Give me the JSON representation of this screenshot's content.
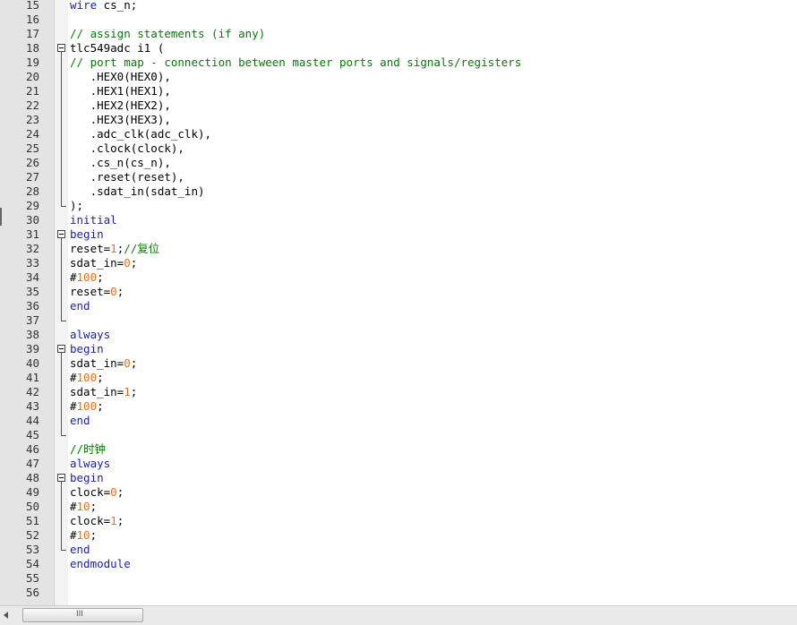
{
  "editor": {
    "lines": [
      {
        "n": "15",
        "fold": false,
        "tokens": [
          {
            "t": "wire",
            "c": "kw"
          },
          {
            "t": " cs_n;",
            "c": ""
          }
        ]
      },
      {
        "n": "16",
        "fold": false,
        "tokens": []
      },
      {
        "n": "17",
        "fold": false,
        "tokens": [
          {
            "t": "// assign statements (if any)",
            "c": "cm"
          }
        ]
      },
      {
        "n": "18",
        "fold": true,
        "tokens": [
          {
            "t": "tlc549adc i1 (",
            "c": ""
          }
        ]
      },
      {
        "n": "19",
        "fold": false,
        "tokens": [
          {
            "t": "// port map - connection between master ports and signals/registers",
            "c": "cm"
          }
        ]
      },
      {
        "n": "20",
        "fold": false,
        "tokens": [
          {
            "t": "   .HEX0(HEX0),",
            "c": ""
          }
        ]
      },
      {
        "n": "21",
        "fold": false,
        "tokens": [
          {
            "t": "   .HEX1(HEX1),",
            "c": ""
          }
        ]
      },
      {
        "n": "22",
        "fold": false,
        "tokens": [
          {
            "t": "   .HEX2(HEX2),",
            "c": ""
          }
        ]
      },
      {
        "n": "23",
        "fold": false,
        "tokens": [
          {
            "t": "   .HEX3(HEX3),",
            "c": ""
          }
        ]
      },
      {
        "n": "24",
        "fold": false,
        "tokens": [
          {
            "t": "   .adc_clk(adc_clk),",
            "c": ""
          }
        ]
      },
      {
        "n": "25",
        "fold": false,
        "tokens": [
          {
            "t": "   .clock(clock),",
            "c": ""
          }
        ]
      },
      {
        "n": "26",
        "fold": false,
        "tokens": [
          {
            "t": "   .cs_n(cs_n),",
            "c": ""
          }
        ]
      },
      {
        "n": "27",
        "fold": false,
        "tokens": [
          {
            "t": "   .reset(reset),",
            "c": ""
          }
        ]
      },
      {
        "n": "28",
        "fold": false,
        "tokens": [
          {
            "t": "   .sdat_in(sdat_in)",
            "c": ""
          }
        ]
      },
      {
        "n": "29",
        "fold": false,
        "tokens": [
          {
            "t": ");",
            "c": ""
          }
        ]
      },
      {
        "n": "30",
        "fold": false,
        "tokens": [
          {
            "t": "initial",
            "c": "kw"
          }
        ]
      },
      {
        "n": "31",
        "fold": true,
        "tokens": [
          {
            "t": "begin",
            "c": "kw"
          }
        ]
      },
      {
        "n": "32",
        "fold": false,
        "tokens": [
          {
            "t": "reset=",
            "c": ""
          },
          {
            "t": "1",
            "c": "num"
          },
          {
            "t": ";",
            "c": ""
          },
          {
            "t": "//复位",
            "c": "cm"
          }
        ]
      },
      {
        "n": "33",
        "fold": false,
        "tokens": [
          {
            "t": "sdat_in=",
            "c": ""
          },
          {
            "t": "0",
            "c": "num"
          },
          {
            "t": ";",
            "c": ""
          }
        ]
      },
      {
        "n": "34",
        "fold": false,
        "tokens": [
          {
            "t": "#",
            "c": ""
          },
          {
            "t": "100",
            "c": "num"
          },
          {
            "t": ";",
            "c": ""
          }
        ]
      },
      {
        "n": "35",
        "fold": false,
        "tokens": [
          {
            "t": "reset=",
            "c": ""
          },
          {
            "t": "0",
            "c": "num"
          },
          {
            "t": ";",
            "c": ""
          }
        ]
      },
      {
        "n": "36",
        "fold": false,
        "tokens": [
          {
            "t": "end",
            "c": "kw"
          }
        ]
      },
      {
        "n": "37",
        "fold": false,
        "tokens": []
      },
      {
        "n": "38",
        "fold": false,
        "tokens": [
          {
            "t": "always",
            "c": "kw"
          }
        ]
      },
      {
        "n": "39",
        "fold": true,
        "tokens": [
          {
            "t": "begin",
            "c": "kw"
          }
        ]
      },
      {
        "n": "40",
        "fold": false,
        "tokens": [
          {
            "t": "sdat_in=",
            "c": ""
          },
          {
            "t": "0",
            "c": "num"
          },
          {
            "t": ";",
            "c": ""
          }
        ]
      },
      {
        "n": "41",
        "fold": false,
        "tokens": [
          {
            "t": "#",
            "c": ""
          },
          {
            "t": "100",
            "c": "num"
          },
          {
            "t": ";",
            "c": ""
          }
        ]
      },
      {
        "n": "42",
        "fold": false,
        "tokens": [
          {
            "t": "sdat_in=",
            "c": ""
          },
          {
            "t": "1",
            "c": "num"
          },
          {
            "t": ";",
            "c": ""
          }
        ]
      },
      {
        "n": "43",
        "fold": false,
        "tokens": [
          {
            "t": "#",
            "c": ""
          },
          {
            "t": "100",
            "c": "num"
          },
          {
            "t": ";",
            "c": ""
          }
        ]
      },
      {
        "n": "44",
        "fold": false,
        "tokens": [
          {
            "t": "end",
            "c": "kw"
          }
        ]
      },
      {
        "n": "45",
        "fold": false,
        "tokens": []
      },
      {
        "n": "46",
        "fold": false,
        "tokens": [
          {
            "t": "//时钟",
            "c": "cm"
          }
        ]
      },
      {
        "n": "47",
        "fold": false,
        "tokens": [
          {
            "t": "always",
            "c": "kw"
          }
        ]
      },
      {
        "n": "48",
        "fold": true,
        "tokens": [
          {
            "t": "begin",
            "c": "kw"
          }
        ]
      },
      {
        "n": "49",
        "fold": false,
        "tokens": [
          {
            "t": "clock=",
            "c": ""
          },
          {
            "t": "0",
            "c": "num"
          },
          {
            "t": ";",
            "c": ""
          }
        ]
      },
      {
        "n": "50",
        "fold": false,
        "tokens": [
          {
            "t": "#",
            "c": ""
          },
          {
            "t": "10",
            "c": "num"
          },
          {
            "t": ";",
            "c": ""
          }
        ]
      },
      {
        "n": "51",
        "fold": false,
        "tokens": [
          {
            "t": "clock=",
            "c": ""
          },
          {
            "t": "1",
            "c": "num"
          },
          {
            "t": ";",
            "c": ""
          }
        ]
      },
      {
        "n": "52",
        "fold": false,
        "tokens": [
          {
            "t": "#",
            "c": ""
          },
          {
            "t": "10",
            "c": "num"
          },
          {
            "t": ";",
            "c": ""
          }
        ]
      },
      {
        "n": "53",
        "fold": false,
        "tokens": [
          {
            "t": "end",
            "c": "kw"
          }
        ]
      },
      {
        "n": "54",
        "fold": false,
        "tokens": [
          {
            "t": "endmodule",
            "c": "kw"
          }
        ]
      },
      {
        "n": "55",
        "fold": false,
        "tokens": []
      },
      {
        "n": "56",
        "fold": false,
        "tokens": []
      }
    ]
  },
  "scrollbar": {
    "grip": "III"
  },
  "colors": {
    "keyword": "#1a1acc",
    "comment": "#008000",
    "number": "#ff6a00",
    "text": "#000000",
    "gutter": "#e4e4e4"
  }
}
